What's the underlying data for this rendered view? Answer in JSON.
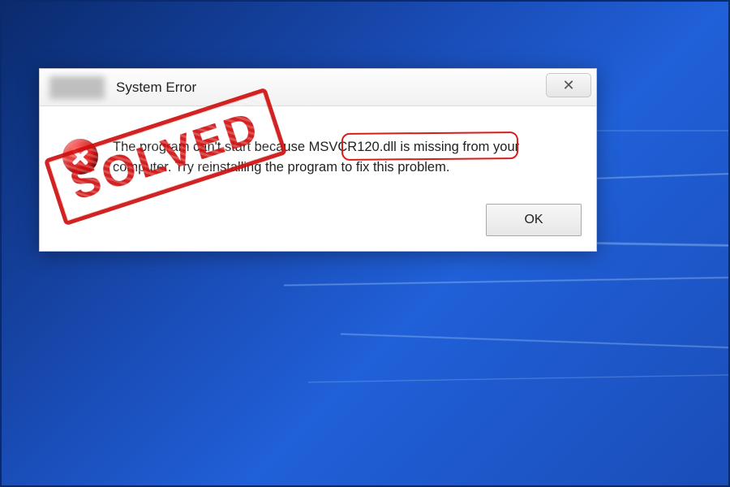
{
  "dialog": {
    "title": "System Error",
    "close_glyph": "✕",
    "message_line1_pre": "The program can't start because ",
    "message_highlight": "MSVCR120.dll is missing",
    "message_line1_post": " from your",
    "message_line2": "computer. Try reinstalling the program to fix this problem.",
    "ok_label": "OK"
  },
  "overlay": {
    "stamp_text": "SOLVED"
  },
  "colors": {
    "stamp": "#cf1010",
    "highlight_border": "#d81b1b"
  }
}
